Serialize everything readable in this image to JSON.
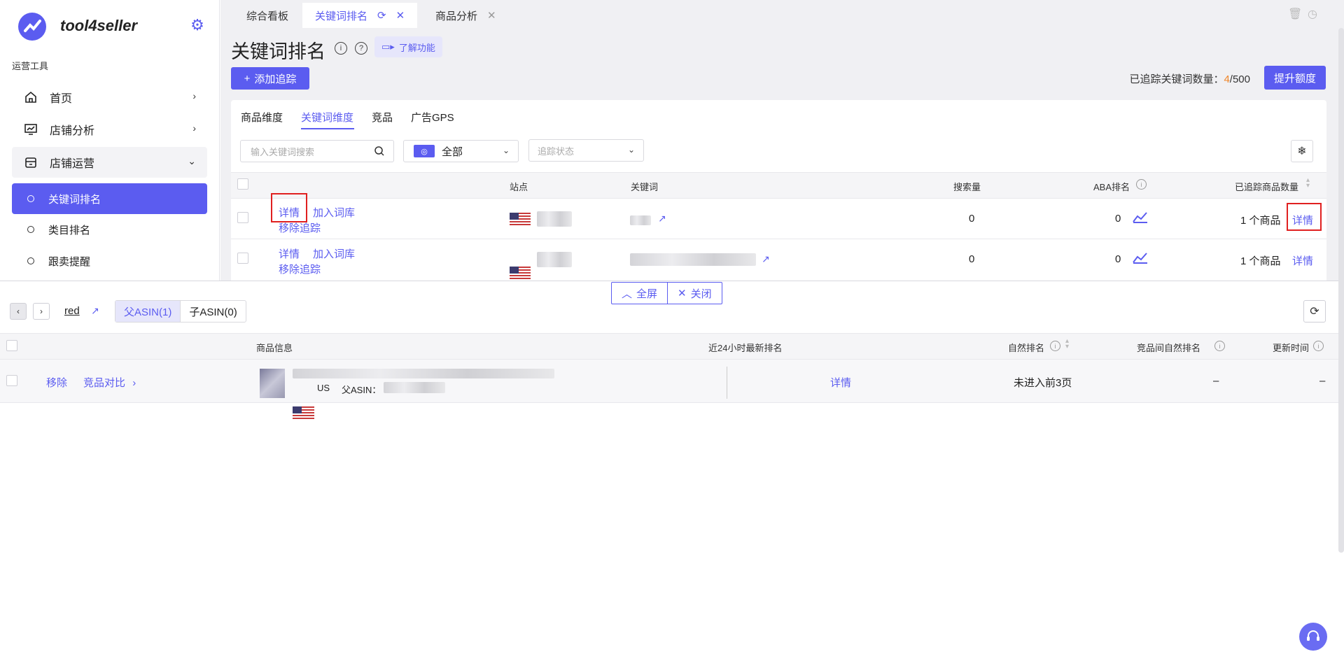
{
  "brand": {
    "name": "tool4seller",
    "accent": "#5b5cf0"
  },
  "sidebar": {
    "section_label": "运营工具",
    "items": [
      {
        "label": "首页",
        "icon": "home-icon"
      },
      {
        "label": "店铺分析",
        "icon": "chart-board-icon"
      },
      {
        "label": "店铺运营",
        "icon": "store-icon"
      }
    ],
    "sub_items": [
      {
        "label": "关键词排名",
        "active": true
      },
      {
        "label": "类目排名",
        "active": false
      },
      {
        "label": "跟卖提醒",
        "active": false
      }
    ]
  },
  "tabs": [
    {
      "label": "综合看板"
    },
    {
      "label": "关键词排名"
    },
    {
      "label": "商品分析"
    }
  ],
  "page": {
    "title": "关键词排名",
    "learn_label": "了解功能",
    "add_label": "添加追踪",
    "tracked_label": "已追踪关键词数量：",
    "tracked_used": "4",
    "tracked_total": "/500",
    "raise_label": "提升额度"
  },
  "dimension_tabs": [
    "商品维度",
    "关键词维度",
    "竞品",
    "广告GPS"
  ],
  "filters": {
    "search_placeholder": "输入关键词搜索",
    "site_value": "全部",
    "status_placeholder": "追踪状态"
  },
  "table": {
    "headers": [
      "站点",
      "关键词",
      "搜索量",
      "ABA排名",
      "已追踪商品数量"
    ],
    "actions": {
      "detail": "详情",
      "add_lib": "加入词库",
      "remove": "移除追踪"
    },
    "rows": [
      {
        "search_volume": "0",
        "aba_rank": "0",
        "product_count": "1 个商品",
        "detail": "详情"
      },
      {
        "search_volume": "0",
        "aba_rank": "0",
        "product_count": "1 个商品",
        "detail": "详情"
      }
    ]
  },
  "split": {
    "fullscreen": "全屏",
    "close": "关闭"
  },
  "detail_panel": {
    "keyword": "red",
    "tabs": [
      "父ASIN(1)",
      "子ASIN(0)"
    ],
    "headers": [
      "商品信息",
      "近24小时最新排名",
      "自然排名",
      "竞品间自然排名",
      "更新时间"
    ],
    "row": {
      "remove": "移除",
      "compare": "竞品对比",
      "site": "US",
      "parent_asin_label": "父ASIN：",
      "latest": "详情",
      "natural_rank": "未进入前3页",
      "competitor_rank": "–",
      "updated": "–"
    }
  }
}
